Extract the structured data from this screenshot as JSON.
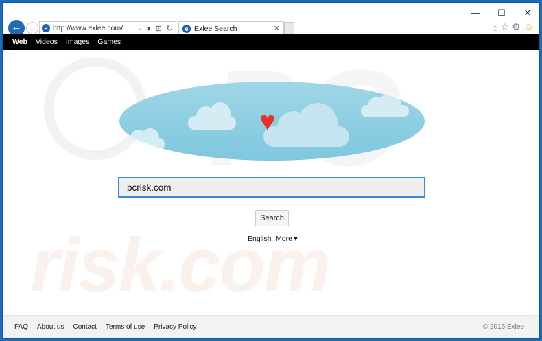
{
  "window": {
    "minimize": "—",
    "maximize": "☐",
    "close": "✕"
  },
  "browser": {
    "back_icon": "back-arrow-icon",
    "forward_icon": "forward-arrow-icon",
    "address": "http://www.exlee.com/",
    "addr_search": "⌕",
    "addr_dropdown": "▾",
    "addr_lock": "⊡",
    "addr_refresh": "↻",
    "tab_title": "Exlee Search",
    "tab_close": "✕",
    "home_icon": "⌂",
    "star_icon": "☆",
    "gear_icon": "⚙",
    "smiley_icon": "☺"
  },
  "nav": {
    "items": [
      "Web",
      "Videos",
      "Images",
      "Games"
    ]
  },
  "search": {
    "value": "pcrisk.com",
    "button": "Search"
  },
  "lang": {
    "current": "English",
    "more": "More▼"
  },
  "watermark": {
    "top": "PC",
    "bottom": "risk.com"
  },
  "footer": {
    "links": [
      "FAQ",
      "About us",
      "Contact",
      "Terms of use",
      "Privacy Policy"
    ],
    "copyright": "© 2016 Exlee"
  },
  "colors": {
    "accent": "#1e6bb8",
    "nav_bg": "#000000",
    "heart": "#e8312c",
    "sky": "#8fcfe3"
  }
}
